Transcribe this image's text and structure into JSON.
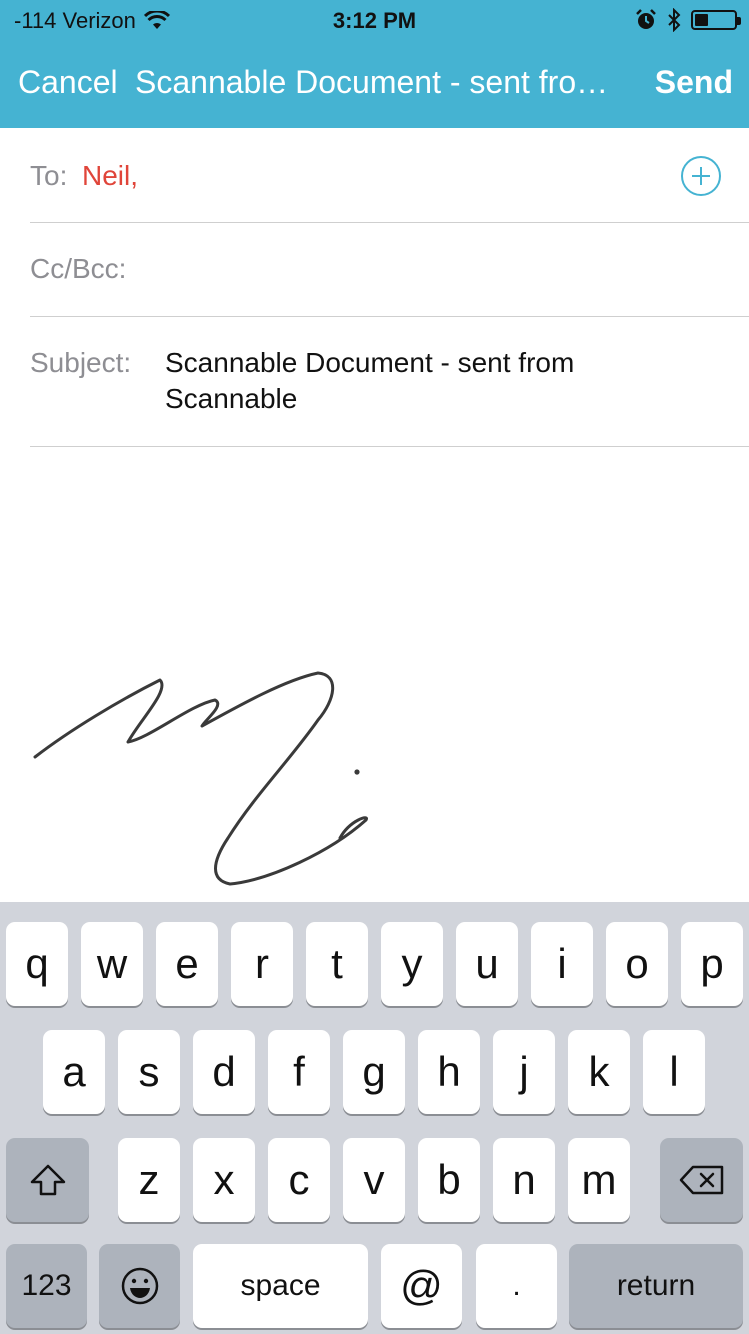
{
  "status_bar": {
    "carrier": "-114 Verizon",
    "time": "3:12 PM",
    "battery_level": 0.35,
    "icons": [
      "wifi-icon",
      "alarm-icon",
      "bluetooth-icon",
      "battery-icon"
    ]
  },
  "nav": {
    "cancel_label": "Cancel",
    "title": "Scannable Document - sent from Scannable",
    "send_label": "Send"
  },
  "compose": {
    "to_label": "To:",
    "recipients": "Neil,",
    "cc_label": "Cc/Bcc:",
    "subject_label": "Subject:",
    "subject_line1": "Scannable Document - sent from",
    "subject_line2": "Scannable"
  },
  "keyboard": {
    "row1": [
      "q",
      "w",
      "e",
      "r",
      "t",
      "y",
      "u",
      "i",
      "o",
      "p"
    ],
    "row2": [
      "a",
      "s",
      "d",
      "f",
      "g",
      "h",
      "j",
      "k",
      "l"
    ],
    "row3": [
      "z",
      "x",
      "c",
      "v",
      "b",
      "n",
      "m"
    ],
    "numbers_label": "123",
    "space_label": "space",
    "at_label": "@",
    "period_label": ".",
    "return_label": "return"
  },
  "colors": {
    "accent": "#45b3d2",
    "recipient": "#e0453a",
    "keyboard_bg": "#d1d4db"
  }
}
